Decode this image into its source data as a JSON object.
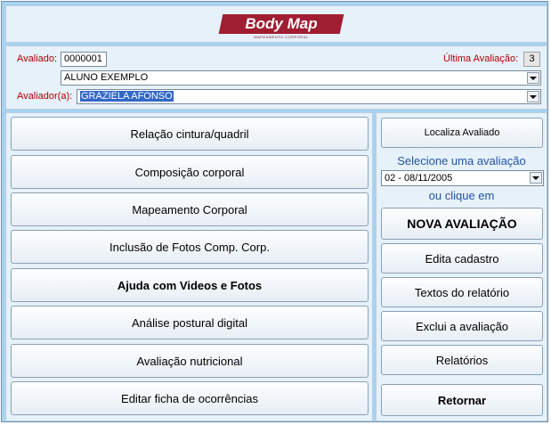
{
  "logo": {
    "title": "Body Map",
    "subtitle": "MAPEAMENTO CORPORAL"
  },
  "form": {
    "avaliado_label": "Avaliado:",
    "avaliado_id": "0000001",
    "ultima_label": "Última Avaliação:",
    "ultima_value": "3",
    "avaliado_name": "ALUNO EXEMPLO",
    "avaliador_label": "Avaliador(a):",
    "avaliador_name": "GRAZIELA AFONSO"
  },
  "left_buttons": [
    "Relação cintura/quadril",
    "Composição corporal",
    "Mapeamento Corporal",
    "Inclusão de Fotos Comp. Corp.",
    "Ajuda com Videos e Fotos",
    "Análise postural digital",
    "Avaliação nutricional",
    "Editar ficha de ocorrências"
  ],
  "right": {
    "localiza": "Localiza Avaliado",
    "select_label": "Selecione uma avaliação",
    "select_value": "02 - 08/11/2005",
    "or_label": "ou clique em",
    "nova": "NOVA AVALIAÇÃO",
    "edita": "Edita cadastro",
    "textos": "Textos do relatório",
    "exclui": "Exclui a avaliação",
    "relatorios": "Relatórios",
    "retornar": "Retornar"
  },
  "icons": [
    "dropdown-arrow-icon"
  ],
  "colors": {
    "background": "#a9d2f0",
    "panel": "#e6f1fa",
    "label_red": "#b30000",
    "logo_red": "#a01e32",
    "link_blue": "#2255a4"
  }
}
